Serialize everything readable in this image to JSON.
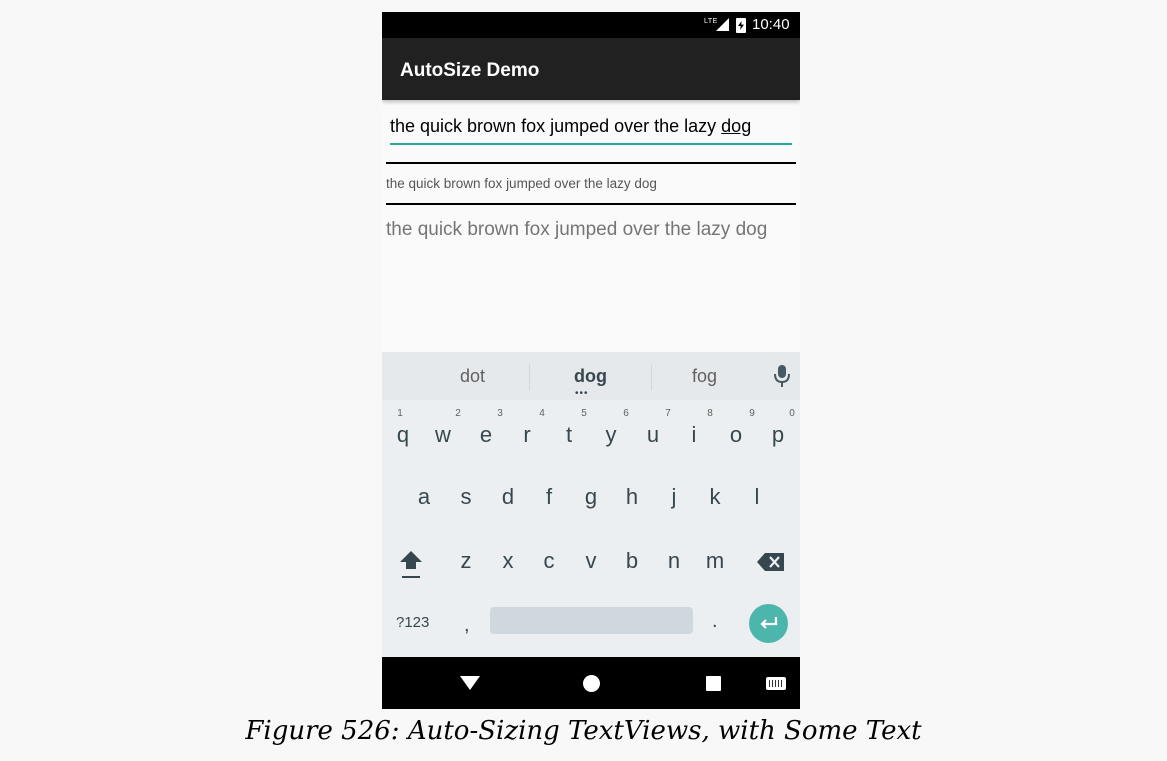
{
  "status_bar": {
    "network": "LTE",
    "time": "10:40"
  },
  "app_bar": {
    "title": "AutoSize Demo"
  },
  "content": {
    "edit_text_prefix": "the quick brown fox jumped over the lazy ",
    "edit_text_last_word": "dog",
    "small_text": "the quick brown fox jumped over the lazy dog",
    "large_text": "the quick brown fox jumped over the lazy dog"
  },
  "keyboard": {
    "suggestions": [
      "dot",
      "dog",
      "fog"
    ],
    "suggestion_dots": "•••",
    "row1": [
      "q",
      "w",
      "e",
      "r",
      "t",
      "y",
      "u",
      "i",
      "o",
      "p"
    ],
    "row1_hints": [
      "1",
      "2",
      "3",
      "4",
      "5",
      "6",
      "7",
      "8",
      "9",
      "0"
    ],
    "row2": [
      "a",
      "s",
      "d",
      "f",
      "g",
      "h",
      "j",
      "k",
      "l"
    ],
    "row3": [
      "z",
      "x",
      "c",
      "v",
      "b",
      "n",
      "m"
    ],
    "symbols_key": "?123",
    "comma_key": ",",
    "period_key": "."
  },
  "colors": {
    "accent": "#26a69a",
    "enter_button": "#4db6ac",
    "app_bar": "#212121"
  },
  "icons": [
    "mic-icon",
    "shift-icon",
    "backspace-icon",
    "enter-icon",
    "nav-back-icon",
    "nav-home-icon",
    "nav-recents-icon",
    "nav-keyboard-icon",
    "lte-signal-icon",
    "battery-icon"
  ],
  "caption": "Figure 526: Auto-Sizing TextViews, with Some Text"
}
